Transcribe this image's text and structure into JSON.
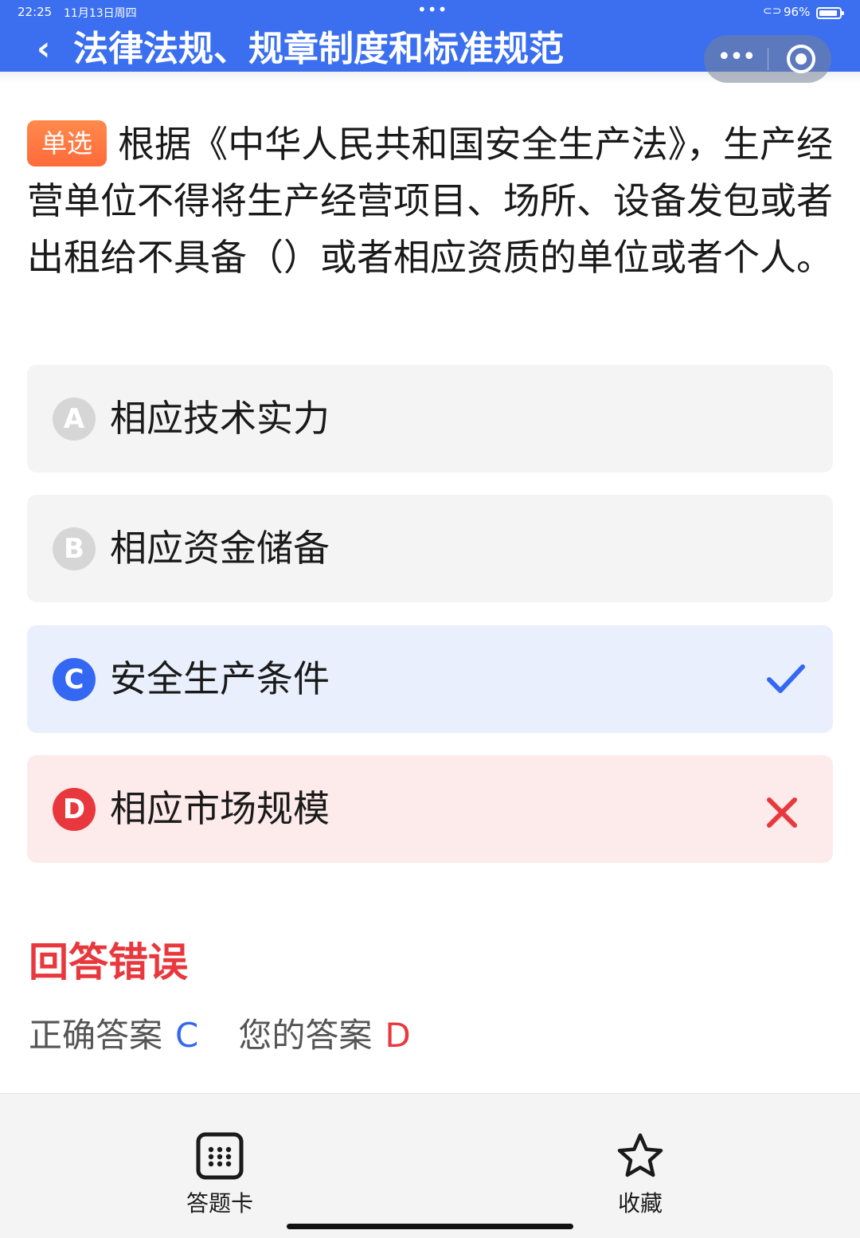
{
  "status_bar": {
    "time": "22:25",
    "date": "11月13日周四",
    "dots": "•••",
    "battery_percent": "96%"
  },
  "header": {
    "back_glyph": "‹",
    "title": "法律法规、规章制度和标准规范",
    "more_glyph": "•••",
    "background_color": "#3b6ff0"
  },
  "question": {
    "type_tag": "单选",
    "text": "根据《中华人民共和国安全生产法》，生产经营单位不得将生产经营项目、场所、设备发包或者出租给不具备（）或者相应资质的单位或者个人。"
  },
  "options": [
    {
      "letter": "A",
      "text": "相应技术实力",
      "state": "neutral"
    },
    {
      "letter": "B",
      "text": "相应资金储备",
      "state": "neutral"
    },
    {
      "letter": "C",
      "text": "安全生产条件",
      "state": "correct",
      "mark_icon": "check-icon"
    },
    {
      "letter": "D",
      "text": "相应市场规模",
      "state": "wrong",
      "mark_icon": "cross-icon"
    }
  ],
  "result": {
    "title": "回答错误",
    "correct_label": "正确答案",
    "correct_value": "C",
    "yours_label": "您的答案",
    "yours_value": "D"
  },
  "bottom_bar": {
    "card_label": "答题卡",
    "card_icon": "grid-icon",
    "fav_label": "收藏",
    "fav_icon": "star-icon"
  },
  "colors": {
    "accent_blue": "#3468f2",
    "error_red": "#e8383d",
    "tag_orange": "#ff7a42"
  }
}
